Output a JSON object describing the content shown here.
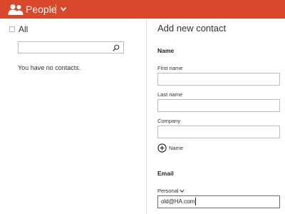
{
  "app": {
    "title": "People",
    "icon": "people-icon",
    "menu_icon": "chevron-down-icon"
  },
  "contacts_list": {
    "select_all_label": "All",
    "search": {
      "value": "",
      "placeholder": "",
      "icon": "search-icon"
    },
    "empty_message": "You have no contacts."
  },
  "new_contact": {
    "title": "Add new contact",
    "name_section": {
      "heading": "Name",
      "first_name": {
        "label": "First name",
        "value": ""
      },
      "last_name": {
        "label": "Last name",
        "value": ""
      },
      "company": {
        "label": "Company",
        "value": ""
      },
      "add_button": {
        "label": "Name",
        "icon": "plus-circle-icon"
      }
    },
    "email_section": {
      "heading": "Email",
      "type_select": {
        "label": "Personal",
        "icon": "chevron-down-icon"
      },
      "email": {
        "value": "old@HA.com"
      }
    }
  },
  "colors": {
    "header_bg": "#d9482b",
    "header_text": "#ffffff"
  }
}
